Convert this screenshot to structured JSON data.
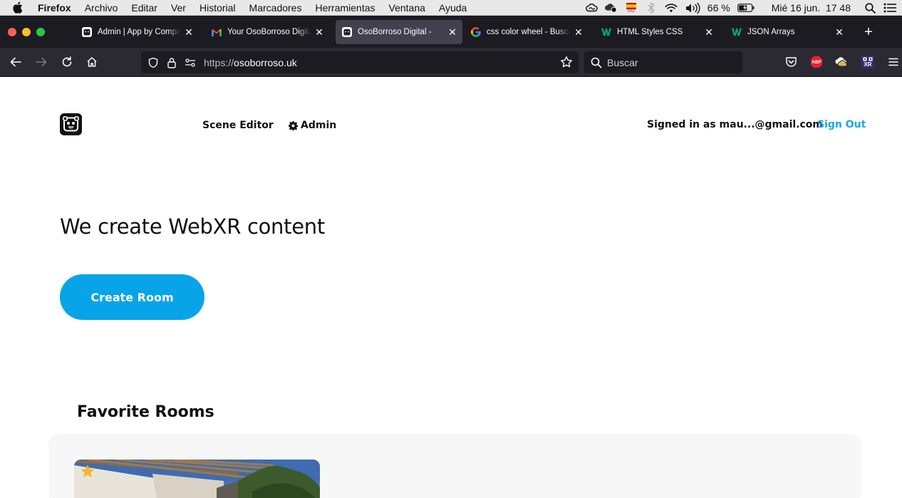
{
  "menubar": {
    "app_name": "Firefox",
    "items": [
      "Archivo",
      "Editar",
      "Ver",
      "Historial",
      "Marcadores",
      "Herramientas",
      "Ventana",
      "Ayuda"
    ],
    "status": {
      "battery": "66 %",
      "datetime": "Mié 16 jun.  17 48",
      "flag_label": "ISO"
    }
  },
  "tabs": [
    {
      "title": "Admin | App by Company",
      "favicon": "bear-icon",
      "active": false
    },
    {
      "title": "Your OsoBorroso Digital",
      "favicon": "gmail-icon",
      "active": false
    },
    {
      "title": "OsoBorroso Digital -",
      "favicon": "bear-icon",
      "active": true
    },
    {
      "title": "css color wheel - Buscar",
      "favicon": "google-icon",
      "active": false
    },
    {
      "title": "HTML Styles CSS",
      "favicon": "w3schools-icon",
      "active": false
    },
    {
      "title": "JSON Arrays",
      "favicon": "w3schools-icon",
      "active": false
    }
  ],
  "navbar": {
    "url_scheme": "https://",
    "url_host": "osoborroso.uk",
    "search_placeholder": "Buscar",
    "abp_label": "ABP",
    "xr_label": "XR"
  },
  "page": {
    "nav": {
      "scene_editor": "Scene Editor",
      "admin": "Admin",
      "signed_in": "Signed in as mau...@gmail.com",
      "sign_out": "Sign Out"
    },
    "hero_title": "We create WebXR content",
    "create_room": "Create Room",
    "favorite_rooms": "Favorite Rooms"
  },
  "colors": {
    "accent": "#07a4e8",
    "signout": "#1aa6e6",
    "tab_active": "#42414d",
    "toolbar": "#2b2a33"
  }
}
